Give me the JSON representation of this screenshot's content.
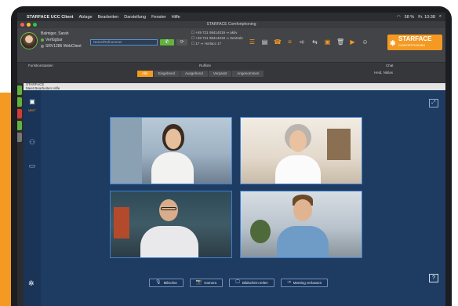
{
  "mac_menu": {
    "apple": "",
    "app": "STARFACE UCC Client",
    "items": [
      "Ablage",
      "Bearbeiten",
      "Darstellung",
      "Fenster",
      "Hilfe"
    ],
    "battery": "58 %",
    "clock": "Fr. 10:38"
  },
  "window": {
    "title": "STARFACE Comfortphoning"
  },
  "user": {
    "name": "Balmiger, Sarah",
    "status": "Verfügbar",
    "device": "SRV1286 WebClient"
  },
  "search": {
    "placeholder": "Name/Rufnummer"
  },
  "call": {
    "dial_glyph": "✆",
    "extra_glyph": "⟳"
  },
  "lines": [
    "+49 721 98414019 ⇒ aktiv",
    "+49 721 98414019 ⇒ Zentrale",
    "17 ⇒ Horlacc 17"
  ],
  "brand": {
    "name": "STARFACE",
    "tagline": "COMFORTPHONING"
  },
  "panels": {
    "left_title": "Funktionstasten",
    "center_title": "Rufliste",
    "right_title": "Chat",
    "right_sub": "Heid, Niklas",
    "tabs": [
      "Alle",
      "Eingehend",
      "Ausgehend",
      "Verpasst",
      "Angenommen"
    ]
  },
  "meeting": {
    "titlebar": "STARFACE",
    "menu": "Meet  Bearbeiten  Hilfe",
    "logo_label": "MEET",
    "controls": [
      {
        "icon": "🎙",
        "label": "Mikrofon"
      },
      {
        "icon": "📷",
        "label": "Kamera"
      },
      {
        "icon": "🖵",
        "label": "Bildschirm teilen"
      },
      {
        "icon": "⇥",
        "label": "Meeting verlassen"
      }
    ],
    "help": "?"
  },
  "colors": {
    "accent": "#f49a22",
    "meeting_bg": "#1e3b62",
    "tile_border": "#3b7fd4"
  }
}
